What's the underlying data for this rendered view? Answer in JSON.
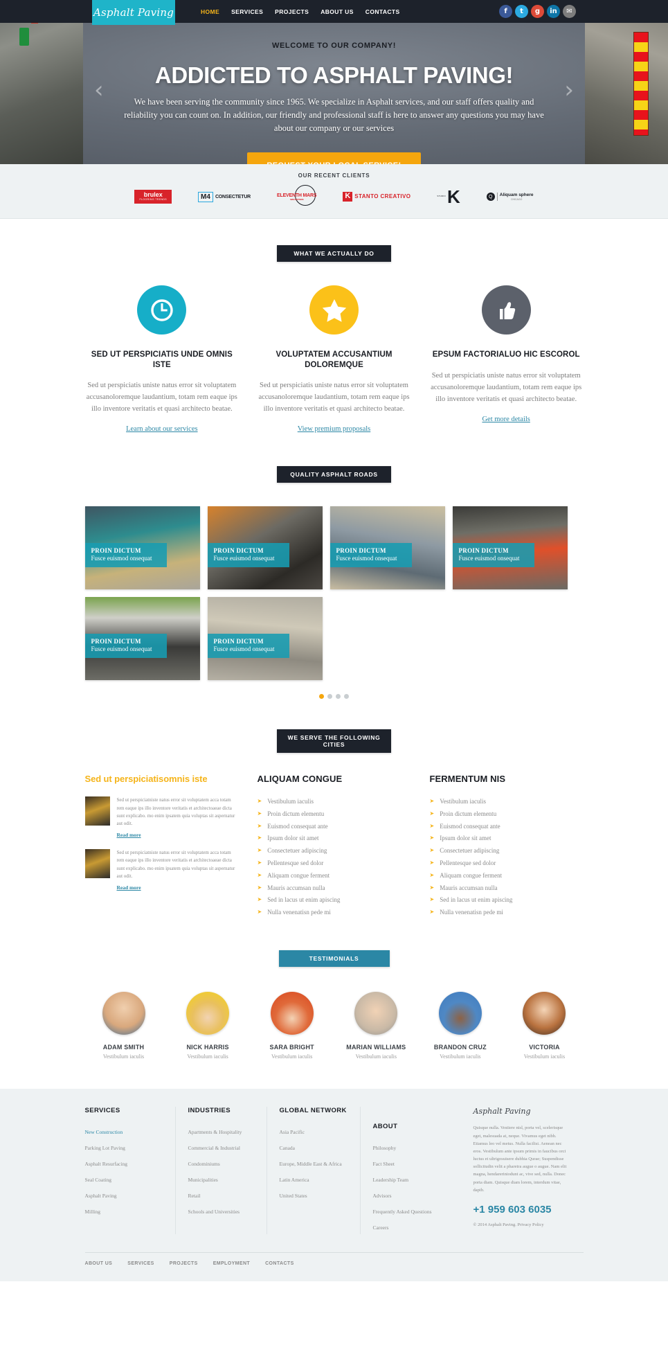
{
  "colors": {
    "brand_teal": "#1fb4c9",
    "accent_yellow": "#f5a60d",
    "dark": "#1d222b",
    "link_blue": "#2b87a5",
    "badge_teal": "#2b87a5",
    "footer_bg": "#eef2f3"
  },
  "header": {
    "logo": "Asphalt Paving",
    "nav": [
      {
        "label": "HOME",
        "active": true
      },
      {
        "label": "SERVICES",
        "active": false
      },
      {
        "label": "PROJECTS",
        "active": false
      },
      {
        "label": "ABOUT US",
        "active": false
      },
      {
        "label": "CONTACTS",
        "active": false
      }
    ],
    "social": [
      {
        "name": "facebook-icon",
        "glyph": "f",
        "cls": "fb"
      },
      {
        "name": "twitter-icon",
        "glyph": "t",
        "cls": "tw"
      },
      {
        "name": "google-plus-icon",
        "glyph": "g",
        "cls": "gp"
      },
      {
        "name": "linkedin-icon",
        "glyph": "in",
        "cls": "in"
      },
      {
        "name": "email-icon",
        "glyph": "✉",
        "cls": "ml"
      }
    ]
  },
  "hero": {
    "welcome": "WELCOME TO OUR COMPANY!",
    "title": "ADDICTED TO ASPHALT PAVING!",
    "subtitle": "We have been serving the community since 1965. We specialize in Asphalt services, and our staff offers quality and reliability you can count on. In addition, our friendly and professional staff is here to answer any questions you may have about our company or our services",
    "cta": "REQUEST YOUR LOCAL SERVICE!",
    "prev_arrow": "‹",
    "next_arrow": "›"
  },
  "clients": {
    "title": "OUR RECENT CLIENTS",
    "logos": [
      {
        "name": "brulex",
        "text": "brulex",
        "sub": "FLOORING TRENDS"
      },
      {
        "name": "m4-consectetur",
        "text": "M4",
        "sub": "CONSECTETUR"
      },
      {
        "name": "eleventh-mars",
        "text": "ELEVENTH MARS",
        "sub": "SIZE MATTERS"
      },
      {
        "name": "stanto-creativo",
        "text": "STANTO CREATIVO",
        "sub": "K"
      },
      {
        "name": "k-studio",
        "text": "K",
        "sub": "STUDIO"
      },
      {
        "name": "aliquam-sphere",
        "text": "Aliquam sphere",
        "sub": "CHICAGO"
      }
    ]
  },
  "services": {
    "badge": "WHAT WE ACTUALLY DO",
    "items": [
      {
        "icon": "clock-icon",
        "color": "#16aec8",
        "heading": "SED UT PERSPICIATIS UNDE OMNIS ISTE",
        "body": "Sed ut perspiciatis uniste natus error sit voluptatem accusanoloremque laudantium, totam rem  eaque ips illo inventore veritatis et quasi architecto beatae.",
        "link": "Learn about our services"
      },
      {
        "icon": "star-icon",
        "color": "#fbc119",
        "heading": "VOLUPTATEM ACCUSANTIUM DOLOREMQUE",
        "body": "Sed ut perspiciatis uniste natus error sit voluptatem accusanoloremque laudantium, totam rem  eaque ips illo inventore veritatis et quasi architecto beatae.",
        "link": "View premium proposals"
      },
      {
        "icon": "thumbs-up-icon",
        "color": "#5c616b",
        "heading": "EPSUM FACTORIALUO HIC ESCOROL",
        "body": "Sed ut perspiciatis uniste natus error sit voluptatem accusanoloremque laudantium, totam rem  eaque ips illo inventore veritatis et quasi architecto beatae.",
        "link": "Get more details"
      }
    ]
  },
  "gallery": {
    "badge": "QUALITY ASPHALT ROADS",
    "items": [
      {
        "title": "PROIN DICTUM",
        "subtitle": "Fusce euismod onsequat",
        "bg": "g1"
      },
      {
        "title": "PROIN DICTUM",
        "subtitle": "Fusce euismod onsequat",
        "bg": "g2"
      },
      {
        "title": "PROIN DICTUM",
        "subtitle": "Fusce euismod onsequat",
        "bg": "g3"
      },
      {
        "title": "PROIN DICTUM",
        "subtitle": "Fusce euismod onsequat",
        "bg": "g4"
      },
      {
        "title": "PROIN DICTUM",
        "subtitle": "Fusce euismod onsequat",
        "bg": "g5"
      },
      {
        "title": "PROIN DICTUM",
        "subtitle": "Fusce euismod onsequat",
        "bg": "g6"
      }
    ],
    "pagination": {
      "total": 4,
      "active_index": 0
    }
  },
  "cities": {
    "badge": "WE SERVE THE FOLLOWING CITIES",
    "left": {
      "heading": "Sed ut perspiciatisomnis iste",
      "posts": [
        {
          "body": "Sed ut perspiciatniste natus error sit voluptatem acca totam rem  eaque ips illo inventore veritatis et architectoaeae dicta sunt explicabo. mo enim ipsatem quia voluptas sit aspernatur aut odit.",
          "link": "Read more"
        },
        {
          "body": "Sed ut perspiciatniste natus error sit voluptatem acca totam rem  eaque ips illo inventore veritatis et architectoaeae dicta sunt explicabo. mo enim ipsatem quia voluptas sit aspernatur aut odit.",
          "link": "Read more"
        }
      ]
    },
    "mid": {
      "heading": "ALIQUAM CONGUE",
      "items": [
        "Vestibulum iaculis",
        "Proin dictum elementu",
        "Euismod consequat ante",
        "Ipsum dolor sit amet",
        "Consectetuer adipiscing",
        "Pellentesque sed dolor",
        "Aliquam congue ferment",
        "Mauris accumsan nulla",
        "Sed in lacus ut enim apiscing",
        "Nulla venenatisn pede mi"
      ]
    },
    "right": {
      "heading": "FERMENTUM NIS",
      "items": [
        "Vestibulum iaculis",
        "Proin dictum elementu",
        "Euismod consequat ante",
        "Ipsum dolor sit amet",
        "Consectetuer adipiscing",
        "Pellentesque sed dolor",
        "Aliquam congue ferment",
        "Mauris accumsan nulla",
        "Sed in lacus ut enim apiscing",
        "Nulla venenatisn pede mi"
      ]
    }
  },
  "testimonials": {
    "badge": "TESTIMONIALS",
    "people": [
      {
        "name": "ADAM SMITH",
        "role": "Vestibulum iaculis",
        "av": "a1"
      },
      {
        "name": "NICK HARRIS",
        "role": "Vestibulum iaculis",
        "av": "a2"
      },
      {
        "name": "SARA BRIGHT",
        "role": "Vestibulum iaculis",
        "av": "a3"
      },
      {
        "name": "MARIAN WILLIAMS",
        "role": "Vestibulum iaculis",
        "av": "a4"
      },
      {
        "name": "BRANDON CRUZ",
        "role": "Vestibulum iaculis",
        "av": "a5"
      },
      {
        "name": "VICTORIA",
        "role": "Vestibulum iaculis",
        "av": "a6"
      }
    ]
  },
  "footer": {
    "services": {
      "heading": "SERVICES",
      "items": [
        {
          "label": "New Construction",
          "active": true
        },
        {
          "label": "Parking Lot Paving",
          "active": false
        },
        {
          "label": "Asphalt Resurfacing",
          "active": false
        },
        {
          "label": "Seal Coating",
          "active": false
        },
        {
          "label": "Asphalt Paving",
          "active": false
        },
        {
          "label": "Milling",
          "active": false
        }
      ]
    },
    "industries": {
      "heading": "INDUSTRIES",
      "items": [
        {
          "label": "Apartments & Hospitality",
          "active": false
        },
        {
          "label": "Commercial & Industrial",
          "active": false
        },
        {
          "label": "Condominiums",
          "active": false
        },
        {
          "label": "Municipalities",
          "active": false
        },
        {
          "label": "Retail",
          "active": false
        },
        {
          "label": "Schools and Universities",
          "active": false
        }
      ]
    },
    "global_network": {
      "heading": "GLOBAL NETWORK",
      "items": [
        {
          "label": "Asia Pacific",
          "active": false
        },
        {
          "label": "Canada",
          "active": false
        },
        {
          "label": "Europe, Middle East & Africa",
          "active": false
        },
        {
          "label": "Latin America",
          "active": false
        },
        {
          "label": "United States",
          "active": false
        }
      ]
    },
    "about": {
      "heading": "ABOUT",
      "items": [
        {
          "label": "Philosophy",
          "active": false
        },
        {
          "label": "Fact Sheet",
          "active": false
        },
        {
          "label": "Leadership Team",
          "active": false
        },
        {
          "label": "Advisors",
          "active": false
        },
        {
          "label": "Frequently Asked Questions",
          "active": false
        },
        {
          "label": "Careers",
          "active": false
        }
      ]
    },
    "brand": {
      "logo": "Asphalt Paving",
      "text": "Quisque nulla. Vestiere nisl, porta vel, scelerisque eget, malesuada at, neque. Vivamus eget nibh. Etiamus leo vel metus. Nulla facilisi. Aenean nec eros. Vestibulum ante ipsum primis in faucibus orci luctus et ultrigosuisere dubhia Qurae; Suspendisse sollicitudin velit a pharetra augue o augue. Nam elit magna, hendareriniodunt ac, vive sed, nulla. Donec porta diam. Quisque diam lorem, interdum vitae, dapib.",
      "phone": "+1 959 603 6035",
      "copyright": "© 2014 Asphalt Paving.",
      "privacy": "Privacy Policy"
    },
    "bottom_nav": [
      "ABOUT US",
      "SERVICES",
      "PROJECTS",
      "EMPLOYMENT",
      "CONTACTS"
    ]
  }
}
